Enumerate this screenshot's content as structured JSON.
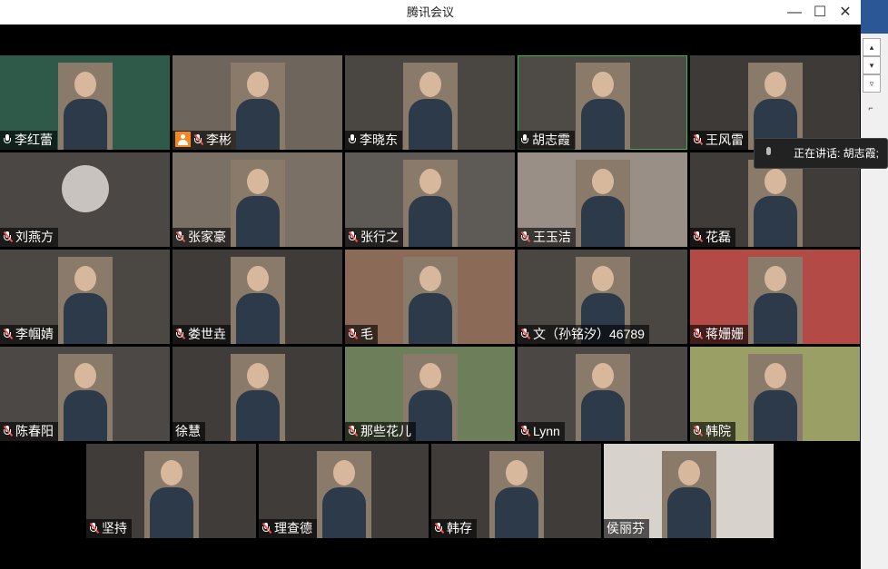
{
  "window": {
    "title": "腾讯会议",
    "minimize_label": "—",
    "maximize_label": "☐",
    "close_label": "✕"
  },
  "speaking_toast": "正在讲话: 胡志霞;",
  "participants": [
    {
      "name": "李红蕾",
      "mic": "on",
      "host": false
    },
    {
      "name": "李彬",
      "mic": "muted",
      "host": true
    },
    {
      "name": "李晓东",
      "mic": "on",
      "host": false
    },
    {
      "name": "胡志霞",
      "mic": "on",
      "host": false,
      "active_speaker": true
    },
    {
      "name": "王风雷",
      "mic": "muted",
      "host": false
    },
    {
      "name": "刘燕方",
      "mic": "muted",
      "host": false
    },
    {
      "name": "张家豪",
      "mic": "muted",
      "host": false
    },
    {
      "name": "张行之",
      "mic": "muted",
      "host": false
    },
    {
      "name": "王玉洁",
      "mic": "muted",
      "host": false
    },
    {
      "name": "花磊",
      "mic": "muted",
      "host": false
    },
    {
      "name": "李帼婧",
      "mic": "muted",
      "host": false
    },
    {
      "name": "娄世垚",
      "mic": "muted",
      "host": false
    },
    {
      "name": "毛",
      "mic": "muted",
      "host": false
    },
    {
      "name": "文（孙铭汐）46789",
      "mic": "muted",
      "host": false
    },
    {
      "name": "蒋姗姗",
      "mic": "muted",
      "host": false
    },
    {
      "name": "陈春阳",
      "mic": "muted",
      "host": false
    },
    {
      "name": "徐慧",
      "mic": "none",
      "host": false
    },
    {
      "name": "那些花儿",
      "mic": "muted",
      "host": false
    },
    {
      "name": "Lynn",
      "mic": "muted",
      "host": false
    },
    {
      "name": "韩院",
      "mic": "muted",
      "host": false
    },
    {
      "name": "坚持",
      "mic": "muted",
      "host": false
    },
    {
      "name": "理查德",
      "mic": "muted",
      "host": false
    },
    {
      "name": "韩存",
      "mic": "muted",
      "host": false
    },
    {
      "name": "侯丽芬",
      "mic": "none",
      "host": false
    }
  ],
  "colors": {
    "tile_bg": "#3a3733",
    "active_border": "#2fbf4a",
    "host_badge": "#f5891f",
    "muted_slash": "#ff4d4d"
  }
}
